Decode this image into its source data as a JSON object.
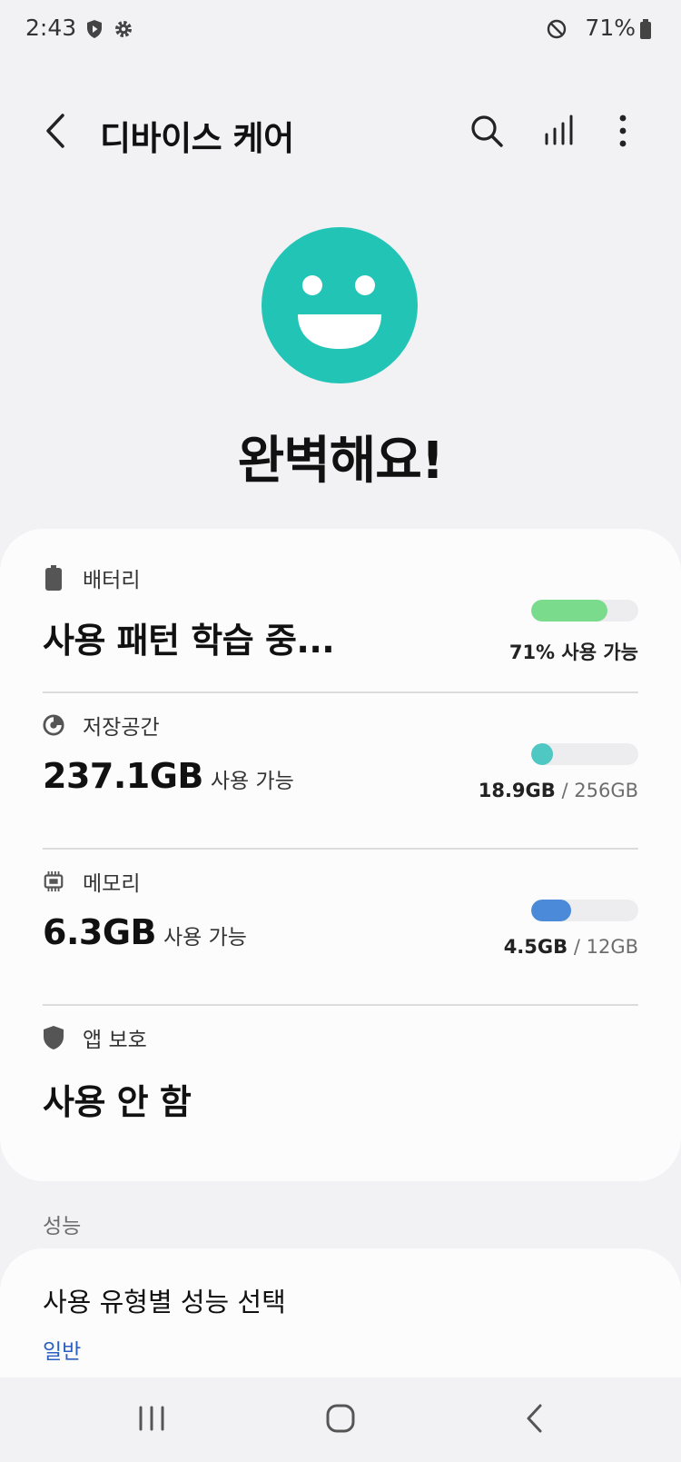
{
  "status_bar": {
    "time": "2:43",
    "battery_percent": "71%",
    "icons": [
      "shield-play-icon",
      "gear-icon",
      "do-not-disturb-icon",
      "battery-icon"
    ]
  },
  "app_bar": {
    "title": "디바이스 케어",
    "icons": [
      "back-arrow-icon",
      "search-icon",
      "signal-bars-icon",
      "more-vert-icon"
    ]
  },
  "status": {
    "icon": "smiley-face-icon",
    "message": "완벽해요!",
    "accent_color": "#22c4b6"
  },
  "items": {
    "battery": {
      "label": "배터리",
      "icon": "battery-icon",
      "value": "사용 패턴 학습 중...",
      "caption": "71% 사용 가능",
      "bar_fraction": 0.71,
      "bar_color": "#7bdb8d"
    },
    "storage": {
      "label": "저장공간",
      "icon": "pie-chart-icon",
      "value": "237.1GB",
      "value_sub": "사용 가능",
      "used": "18.9GB",
      "sep": "/",
      "total": "256GB",
      "bar_fraction": 0.074,
      "bar_color": "#4fc7c2"
    },
    "memory": {
      "label": "메모리",
      "icon": "memory-chip-icon",
      "value": "6.3GB",
      "value_sub": "사용 가능",
      "used": "4.5GB",
      "sep": "/",
      "total": "12GB",
      "bar_fraction": 0.375,
      "bar_color": "#4a8ad8"
    },
    "app_protection": {
      "label": "앱 보호",
      "icon": "shield-icon",
      "value": "사용 안 함"
    }
  },
  "performance": {
    "section_title": "성능",
    "title": "사용 유형별 성능 선택",
    "subtitle": "일반"
  },
  "nav_bar": {
    "icons": [
      "recents-icon",
      "home-icon",
      "back-icon"
    ]
  }
}
